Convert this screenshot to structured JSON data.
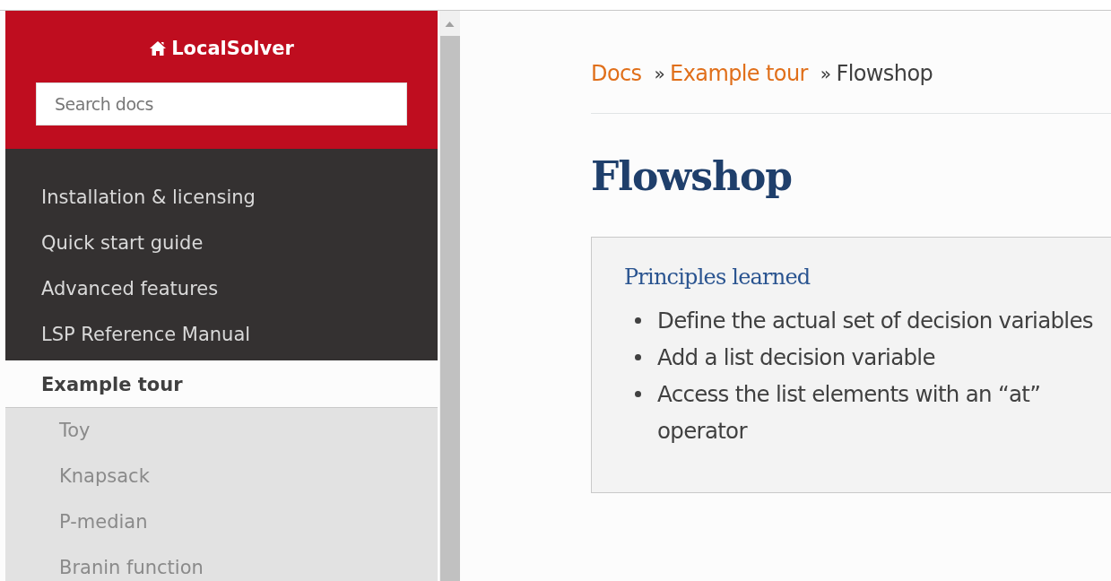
{
  "sidebar": {
    "title": "LocalSolver",
    "search": {
      "placeholder": "Search docs"
    },
    "items": [
      {
        "label": "Installation & licensing",
        "selected": false
      },
      {
        "label": "Quick start guide",
        "selected": false
      },
      {
        "label": "Advanced features",
        "selected": false
      },
      {
        "label": "LSP Reference Manual",
        "selected": false
      },
      {
        "label": "Example tour",
        "selected": true,
        "children": [
          {
            "label": "Toy"
          },
          {
            "label": "Knapsack"
          },
          {
            "label": "P-median"
          },
          {
            "label": "Branin function"
          }
        ]
      }
    ]
  },
  "breadcrumbs": [
    {
      "label": "Docs",
      "link": true
    },
    {
      "label": "Example tour",
      "link": true
    },
    {
      "label": "Flowshop",
      "link": false
    }
  ],
  "breadcrumb_separator": "»",
  "heading": "Flowshop",
  "note": {
    "title": "Principles learned",
    "items": [
      "Define the actual set of decision variables",
      "Add a list decision variable",
      "Access the list elements with an “at” operator"
    ]
  }
}
